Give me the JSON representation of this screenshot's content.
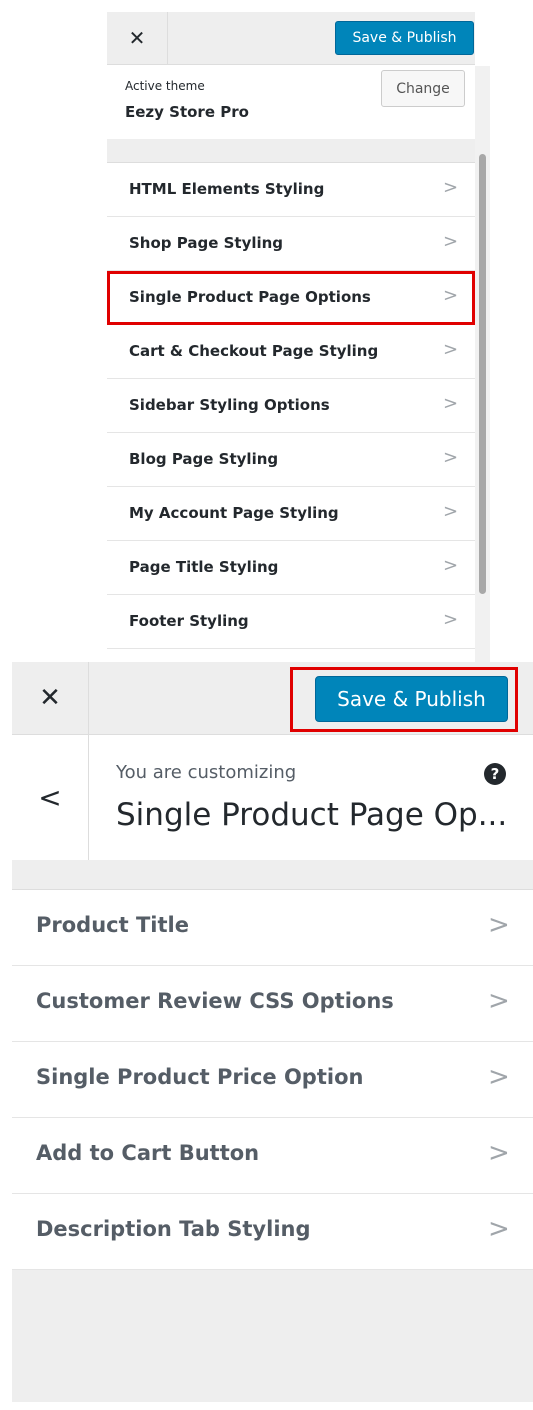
{
  "top_panel": {
    "close_icon": "close-icon",
    "save_label": "Save & Publish",
    "theme_label": "Active theme",
    "theme_name": "Eezy Store Pro",
    "change_label": "Change",
    "items": [
      {
        "label": "HTML Elements Styling"
      },
      {
        "label": "Shop Page Styling"
      },
      {
        "label": "Single Product Page Options"
      },
      {
        "label": "Cart & Checkout Page Styling"
      },
      {
        "label": "Sidebar Styling Options"
      },
      {
        "label": "Blog Page Styling"
      },
      {
        "label": "My Account Page Styling"
      },
      {
        "label": "Page Title Styling"
      },
      {
        "label": "Footer Styling"
      }
    ],
    "highlighted_item": "Single Product Page Options"
  },
  "bottom_panel": {
    "close_icon": "close-icon",
    "save_label": "Save & Publish",
    "customizing_label": "You are customizing",
    "section_title": "Single Product Page Op...",
    "help_icon": "?",
    "back_icon": "chevron-left-icon",
    "items": [
      {
        "label": "Product Title"
      },
      {
        "label": "Customer Review CSS Options"
      },
      {
        "label": "Single Product Price Option"
      },
      {
        "label": "Add to Cart Button"
      },
      {
        "label": "Description Tab Styling"
      }
    ]
  },
  "colors": {
    "accent": "#0085ba",
    "highlight": "#e00000",
    "panel_bg": "#eeeeee"
  }
}
